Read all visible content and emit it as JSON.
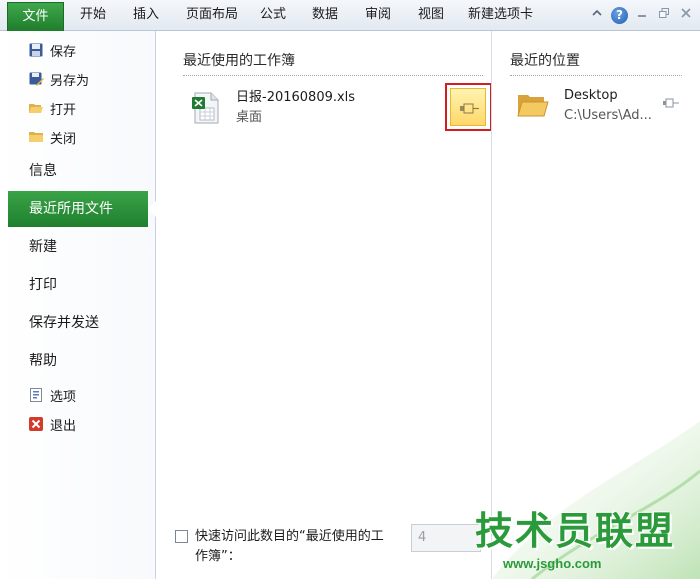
{
  "ribbon": {
    "file_tab": "文件",
    "tabs": [
      "开始",
      "插入",
      "页面布局",
      "公式",
      "数据",
      "审阅",
      "视图",
      "新建选项卡"
    ]
  },
  "window_icons": [
    "chevron-up-icon",
    "help-icon",
    "minimize-icon",
    "restore-icon",
    "close-icon"
  ],
  "nav": {
    "commands": [
      {
        "label": "保存",
        "icon": "save-icon"
      },
      {
        "label": "另存为",
        "icon": "save-as-icon"
      },
      {
        "label": "打开",
        "icon": "open-folder-icon"
      },
      {
        "label": "关闭",
        "icon": "close-folder-icon"
      }
    ],
    "tabs": [
      "信息",
      "最近所用文件",
      "新建",
      "打印",
      "保存并发送",
      "帮助"
    ],
    "active_tab": "最近所用文件",
    "bottom_commands": [
      {
        "label": "选项",
        "icon": "options-icon"
      },
      {
        "label": "退出",
        "icon": "exit-icon"
      }
    ]
  },
  "recent_workbooks": {
    "title": "最近使用的工作簿",
    "items": [
      {
        "name": "日报-20160809.xls",
        "path": "桌面",
        "pinned": false
      }
    ]
  },
  "recent_places": {
    "title": "最近的位置",
    "items": [
      {
        "name": "Desktop",
        "path": "C:\\Users\\Ad..."
      }
    ]
  },
  "quick_access": {
    "label": "快速访问此数目的“最近使用的工作簿”：",
    "value": "4",
    "checked": false
  },
  "watermark": {
    "text": "技术员联盟",
    "site": "www.jsgho.com"
  },
  "colors": {
    "accent_green": "#1f7f2d",
    "pin_highlight": "#ffd86a",
    "annotation_red": "#d21e1e"
  }
}
